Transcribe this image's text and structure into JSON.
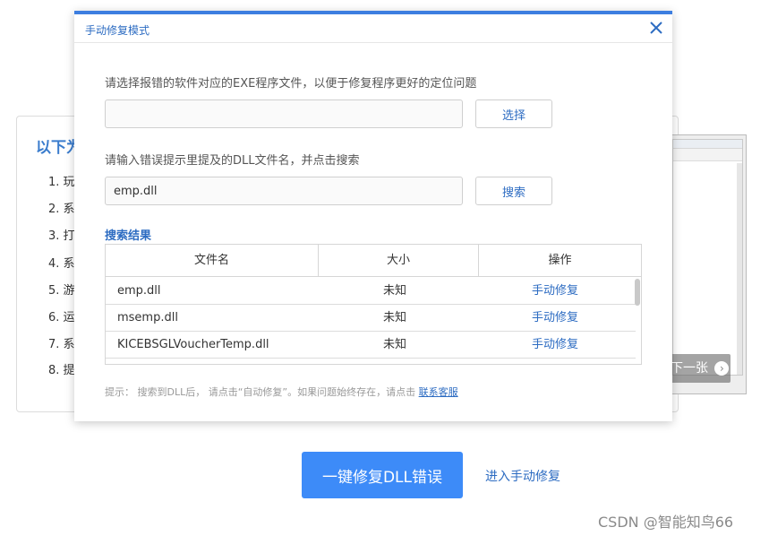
{
  "background": {
    "title": "以下为",
    "steps": [
      "1. 玩",
      "2. 系",
      "3. 打",
      "4. 系",
      "5. 游",
      "6. 运",
      "7. 系",
      "8. 提"
    ],
    "next_label": "下一张",
    "one_click_button": "一键修复DLL错误",
    "manual_link": "进入手动修复",
    "watermark": "CSDN @智能知鸟66"
  },
  "modal": {
    "title": "手动修复模式",
    "exe_prompt": "请选择报错的软件对应的EXE程序文件，以便于修复程序更好的定位问题",
    "exe_value": "",
    "select_label": "选择",
    "dll_prompt": "请输入错误提示里提及的DLL文件名，并点击搜索",
    "dll_value": "emp.dll",
    "search_label": "搜索",
    "results_title": "搜索结果",
    "columns": [
      "文件名",
      "大小",
      "操作"
    ],
    "rows": [
      {
        "name": "emp.dll",
        "size": "未知",
        "action": "手动修复"
      },
      {
        "name": "msemp.dll",
        "size": "未知",
        "action": "手动修复"
      },
      {
        "name": "KICEBSGLVoucherTemp.dll",
        "size": "未知",
        "action": "手动修复"
      }
    ],
    "hint_text": "提示：  搜索到DLL后，  请点击“自动修复”。如果问题始终存在，请点击",
    "hint_link": "联系客服"
  },
  "colors": {
    "accent": "#3d7ee0",
    "link": "#2d6cc2",
    "primary_button": "#3d8bf8"
  }
}
